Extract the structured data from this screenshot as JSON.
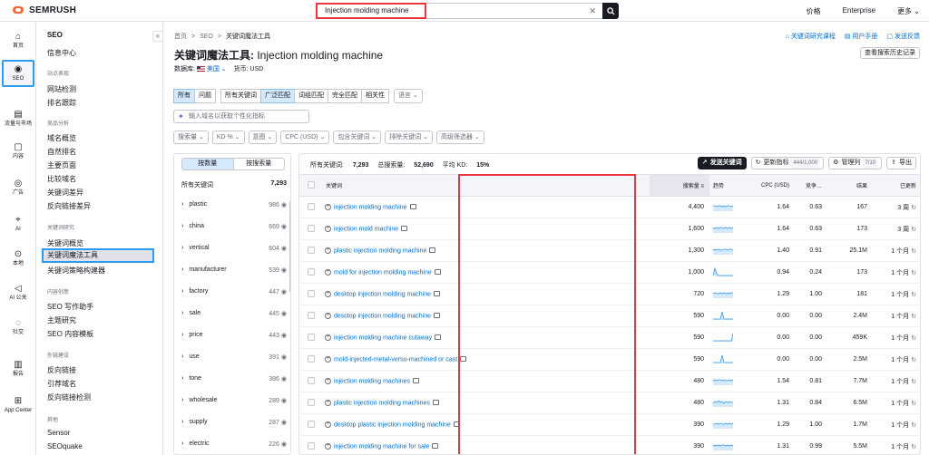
{
  "top": {
    "logo": "SEMRUSH",
    "search_value": "Injection molding machine",
    "clear": "✕",
    "links": [
      "价格",
      "Enterprise",
      "更多 ⌄"
    ]
  },
  "rail": [
    {
      "label": "首页",
      "icon": "⌂"
    },
    {
      "label": "SEO",
      "icon": "◉"
    },
    {
      "label": "流量与市场",
      "icon": "▤"
    },
    {
      "label": "内容",
      "icon": "▢"
    },
    {
      "label": "广告",
      "icon": "◎"
    },
    {
      "label": "AI",
      "icon": "⌖"
    },
    {
      "label": "本地",
      "icon": "⊙"
    },
    {
      "label": "AI 公关",
      "icon": "◁"
    },
    {
      "label": "社交",
      "icon": "◌"
    },
    {
      "label": "报告",
      "icon": "▥"
    },
    {
      "label": "App Center",
      "icon": "⊞"
    }
  ],
  "nav": {
    "title": "SEO",
    "dashboard": "信息中心",
    "s1": "站点表现",
    "s1_items": [
      "网站检测",
      "排名跟踪"
    ],
    "s2": "竞品分析",
    "s2_items": [
      "域名概览",
      "自然排名",
      "主要页面",
      "比较域名",
      "关键词差异",
      "反向链接差异"
    ],
    "s3": "关键词研究",
    "s3_items": [
      "关键词概览",
      "关键词魔法工具",
      "关键词策略构建器"
    ],
    "s4": "内容创意",
    "s4_items": [
      "SEO 写作助手",
      "主题研究",
      "SEO 内容模板"
    ],
    "s5": "外链建设",
    "s5_items": [
      "反向链接",
      "引荐域名",
      "反向链接检测"
    ],
    "s6": "其他",
    "s6_items": [
      "Sensor",
      "SEOquake"
    ]
  },
  "main": {
    "breadcrumb": [
      "首页",
      ">",
      "SEO",
      ">",
      "关键词魔法工具"
    ],
    "title_prefix": "关键词魔法工具:",
    "title_kw": "Injection molding machine",
    "db_label": "数据库:",
    "db_value": "美国 ⌄",
    "currency": "货币: USD",
    "links": [
      "关键词研究课程",
      "用户手册",
      "发送反馈"
    ],
    "history": "查看搜索历史记录",
    "tabs1": [
      "所有",
      "问题"
    ],
    "tabs2": [
      "所有关键词",
      "广泛匹配",
      "词组匹配",
      "完全匹配",
      "相关性"
    ],
    "lang": "语言 ⌄",
    "domain_placeholder": "输入域名以获取个性化指标",
    "filters": [
      "搜索量 ⌄",
      "KD % ⌄",
      "意图 ⌄",
      "CPC (USD) ⌄",
      "包含关键词 ⌄",
      "排除关键词 ⌄",
      "高级筛选器 ⌄"
    ]
  },
  "groups": {
    "toggle": [
      "按数量",
      "按搜索量"
    ],
    "head_label": "所有关键词",
    "head_count": "7,293",
    "items": [
      {
        "name": "plastic",
        "count": "986"
      },
      {
        "name": "china",
        "count": "669"
      },
      {
        "name": "vertical",
        "count": "604"
      },
      {
        "name": "manufacturer",
        "count": "539"
      },
      {
        "name": "factory",
        "count": "447"
      },
      {
        "name": "sale",
        "count": "445"
      },
      {
        "name": "price",
        "count": "443"
      },
      {
        "name": "use",
        "count": "391"
      },
      {
        "name": "tone",
        "count": "386"
      },
      {
        "name": "wholesale",
        "count": "289"
      },
      {
        "name": "supply",
        "count": "287"
      },
      {
        "name": "electric",
        "count": "226"
      }
    ]
  },
  "table": {
    "stats": {
      "all_label": "所有关键词:",
      "all_value": "7,293",
      "vol_label": "总搜索量:",
      "vol_value": "52,690",
      "kd_label": "平均 KD:",
      "kd_value": "15%"
    },
    "buttons": {
      "send": "发送关键词",
      "refresh": "更新指标",
      "refresh_count": "444/1,000",
      "manage": "管理列",
      "manage_count": "7/10",
      "export": "导出"
    },
    "headers": {
      "keyword": "关键词",
      "volume": "搜索量",
      "trend": "趋势",
      "cpc": "CPC (USD)",
      "comp": "竞争…",
      "results": "结果",
      "updated": "已更新"
    },
    "rows": [
      {
        "kw": "injection molding machine",
        "vol": "4,400",
        "cpc": "1.64",
        "comp": "0.63",
        "res": "167",
        "upd": "3 周",
        "trend": [
          6,
          6,
          5,
          6,
          6,
          5,
          6,
          5,
          6,
          6,
          5,
          6
        ]
      },
      {
        "kw": "injection mold machine",
        "vol": "1,600",
        "cpc": "1.64",
        "comp": "0.63",
        "res": "173",
        "upd": "3 周",
        "trend": [
          6,
          5,
          6,
          5,
          6,
          6,
          5,
          6,
          5,
          6,
          5,
          6
        ]
      },
      {
        "kw": "plastic injection molding machine",
        "vol": "1,300",
        "cpc": "1.40",
        "comp": "0.91",
        "res": "25.1M",
        "upd": "1 个月",
        "trend": [
          5,
          6,
          5,
          6,
          5,
          5,
          6,
          6,
          5,
          6,
          6,
          5
        ]
      },
      {
        "kw": "mold for injection molding machine",
        "vol": "1,000",
        "cpc": "0.94",
        "comp": "0.24",
        "res": "173",
        "upd": "1 个月",
        "trend": [
          1,
          9,
          3,
          1,
          1,
          1,
          1,
          1,
          1,
          1,
          1,
          1
        ]
      },
      {
        "kw": "desktop injection molding machine",
        "vol": "720",
        "cpc": "1.29",
        "comp": "1.00",
        "res": "181",
        "upd": "1 个月",
        "trend": [
          5,
          6,
          5,
          5,
          6,
          5,
          6,
          5,
          6,
          5,
          6,
          6
        ]
      },
      {
        "kw": "desctop injection molding machine",
        "vol": "590",
        "cpc": "0.00",
        "comp": "0.00",
        "res": "2.4M",
        "upd": "1 个月",
        "trend": [
          1,
          1,
          1,
          1,
          1,
          9,
          1,
          1,
          1,
          1,
          1,
          1
        ]
      },
      {
        "kw": "injection molding machine cutaway",
        "vol": "590",
        "cpc": "0.00",
        "comp": "0.00",
        "res": "459K",
        "upd": "1 个月",
        "trend": [
          1,
          1,
          1,
          1,
          1,
          1,
          1,
          1,
          1,
          1,
          1,
          9
        ]
      },
      {
        "kw": "mold-injected-metal-versu-machined or cast",
        "vol": "590",
        "cpc": "0.00",
        "comp": "0.00",
        "res": "2.5M",
        "upd": "1 个月",
        "trend": [
          1,
          1,
          1,
          1,
          1,
          9,
          1,
          1,
          1,
          1,
          1,
          1
        ]
      },
      {
        "kw": "injection molding machines",
        "vol": "480",
        "cpc": "1.54",
        "comp": "0.81",
        "res": "7.7M",
        "upd": "1 个月",
        "trend": [
          5,
          6,
          5,
          6,
          6,
          5,
          6,
          5,
          5,
          6,
          5,
          6
        ]
      },
      {
        "kw": "plastic injection molding machines",
        "vol": "480",
        "cpc": "1.31",
        "comp": "0.84",
        "res": "6.5M",
        "upd": "1 个月",
        "trend": [
          4,
          6,
          5,
          7,
          5,
          6,
          4,
          6,
          5,
          6,
          5,
          5
        ]
      },
      {
        "kw": "desktop plastic injection molding machine",
        "vol": "390",
        "cpc": "1.29",
        "comp": "1.00",
        "res": "1.7M",
        "upd": "1 个月",
        "trend": [
          5,
          5,
          6,
          5,
          6,
          5,
          5,
          6,
          5,
          6,
          5,
          6
        ]
      },
      {
        "kw": "injection molding machine for sale",
        "vol": "390",
        "cpc": "1.31",
        "comp": "0.99",
        "res": "5.5M",
        "upd": "1 个月",
        "trend": [
          5,
          6,
          5,
          6,
          5,
          6,
          6,
          5,
          6,
          5,
          6,
          5
        ]
      }
    ]
  }
}
